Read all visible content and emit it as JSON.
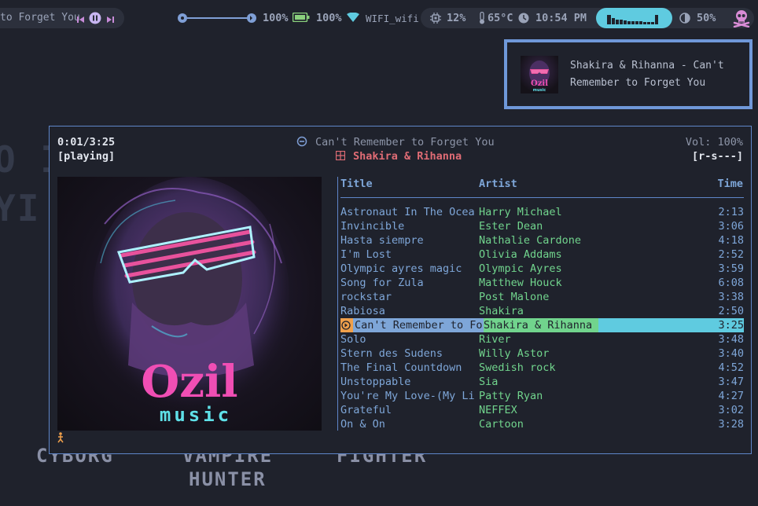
{
  "topbar": {
    "now_playing_marquee": "to Forget You",
    "volume_label": "100%",
    "battery_label": "100%",
    "wifi_label": "WIFI_wifi",
    "cpu_label": "12%",
    "temp_label": "65°C",
    "clock_label": "10:54 PM",
    "brightness_label": "50%",
    "volume_level": 1.0
  },
  "wallpaper": {
    "left_fragment_1": "O I",
    "left_fragment_2": "YI",
    "words": [
      "CYBORG",
      "VAMPIRE",
      "HUNTER",
      "FIGHTER"
    ]
  },
  "notification": {
    "line1": "Shakira & Rihanna - Can't",
    "line2": "Remember to Forget You",
    "cover_word1": "Ozil",
    "cover_word2": "music"
  },
  "player": {
    "elapsed": "0:01/3:25",
    "state": "[playing]",
    "song_title": "Can't Remember to Forget You",
    "song_artist": "Shakira & Rihanna",
    "volume": "Vol: 100%",
    "flags": "[r-s---]",
    "cover_word1": "Ozil",
    "cover_word2": "music",
    "columns": {
      "title": "Title",
      "artist": "Artist",
      "time": "Time"
    },
    "playlist": [
      {
        "title": "Astronaut In The Ocea",
        "artist": "Harry Michael",
        "time": "2:13"
      },
      {
        "title": "Invincible",
        "artist": "Ester Dean",
        "time": "3:06"
      },
      {
        "title": "Hasta siempre",
        "artist": "Nathalie Cardone",
        "time": "4:18"
      },
      {
        "title": "I'm Lost",
        "artist": "Olivia Addams",
        "time": "2:52"
      },
      {
        "title": "Olympic ayres magic",
        "artist": "Olympic Ayres",
        "time": "3:59"
      },
      {
        "title": "Song for Zula",
        "artist": "Matthew Houck",
        "time": "6:08"
      },
      {
        "title": "rockstar",
        "artist": "Post Malone",
        "time": "3:38"
      },
      {
        "title": "Rabiosa",
        "artist": "Shakira",
        "time": "2:50"
      },
      {
        "title": "Can't Remember to Fo",
        "artist": "Shakira & Rihanna",
        "time": "3:25"
      },
      {
        "title": "Solo",
        "artist": "River",
        "time": "3:48"
      },
      {
        "title": "Stern des Sudens",
        "artist": "Willy Astor",
        "time": "3:40"
      },
      {
        "title": "The Final Countdown",
        "artist": "Swedish rock",
        "time": "4:52"
      },
      {
        "title": "Unstoppable",
        "artist": "Sia",
        "time": "3:47"
      },
      {
        "title": "You're My Love-(My Li",
        "artist": "Patty Ryan",
        "time": "4:27"
      },
      {
        "title": "Grateful",
        "artist": "NEFFEX",
        "time": "3:02"
      },
      {
        "title": "On & On",
        "artist": "Cartoon",
        "time": "3:28"
      }
    ],
    "current_index": 8
  },
  "colors": {
    "accent_blue": "#6f98d9",
    "green": "#71d48d",
    "cyan": "#5fcbe0",
    "pink": "#e8529c",
    "red": "#e06c75",
    "skull": "#d98cd6"
  }
}
